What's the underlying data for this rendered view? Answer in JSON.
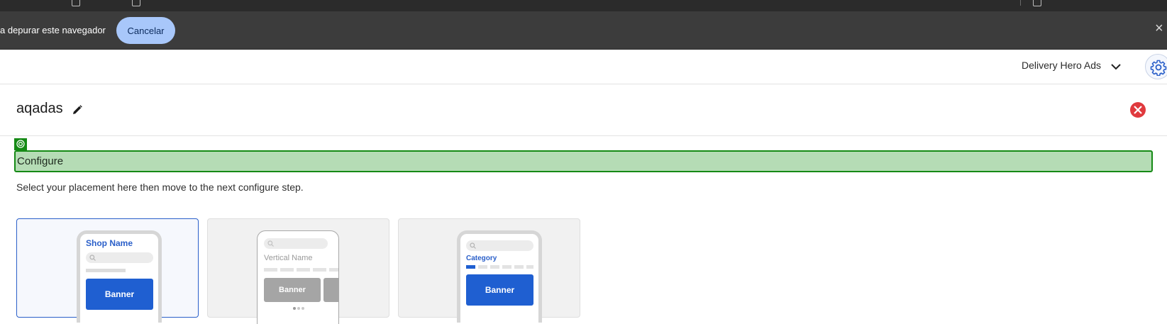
{
  "debug_bar": {
    "message": "a depurar este navegador",
    "cancel_label": "Cancelar",
    "close_symbol": "×"
  },
  "header": {
    "account_name": "Delivery Hero Ads",
    "icons": [
      "chevron-down-icon",
      "gear-icon"
    ]
  },
  "page": {
    "title": "aqadas",
    "icons": [
      "pencil-icon",
      "close-icon"
    ]
  },
  "configure": {
    "heading": "Configure",
    "instructions": "Select your placement here then move to the next configure step."
  },
  "placements": [
    {
      "heading": "Shop Name",
      "banner_label": "Banner",
      "selected": true
    },
    {
      "heading": "Vertical Name",
      "banner_label": "Banner",
      "selected": false
    },
    {
      "heading": "Category",
      "banner_label": "Banner",
      "selected": false
    }
  ],
  "colors": {
    "accent_blue": "#1f5fd1",
    "configure_green": "#158a15",
    "configure_fill": "#b5dcb5",
    "close_red": "#e03a3e",
    "cancel_button": "#a8c7fa"
  }
}
